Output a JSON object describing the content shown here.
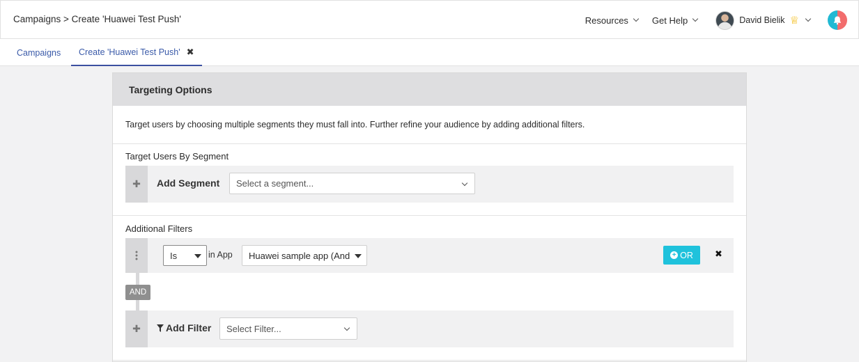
{
  "header": {
    "breadcrumb": "Campaigns > Create 'Huawei Test Push'",
    "nav": {
      "resources": "Resources",
      "get_help": "Get Help"
    },
    "user": {
      "name": "David Bielik",
      "badge_icon": "crown-icon"
    },
    "notifications_icon": "bell-icon"
  },
  "tabs": [
    {
      "label": "Campaigns"
    },
    {
      "label": "Create 'Huawei Test Push'"
    }
  ],
  "panel": {
    "title": "Targeting Options",
    "description": "Target users by choosing multiple segments they must fall into. Further refine your audience by adding additional filters.",
    "segment_section": {
      "title": "Target Users By Segment",
      "add_label": "Add Segment",
      "select_placeholder": "Select a segment..."
    },
    "filters_section": {
      "title": "Additional Filters",
      "filter_row": {
        "operator": "Is",
        "connector_text": "in App",
        "app_value": "Huawei sample app (And",
        "or_label": "OR"
      },
      "and_label": "AND",
      "add_filter_label": "Add Filter",
      "filter_placeholder": "Select Filter..."
    }
  },
  "colors": {
    "accent_cyan": "#1fc2dc",
    "tab_link": "#3b5ba9",
    "panel_header_bg": "#dedee0",
    "crown": "#f2b600"
  }
}
